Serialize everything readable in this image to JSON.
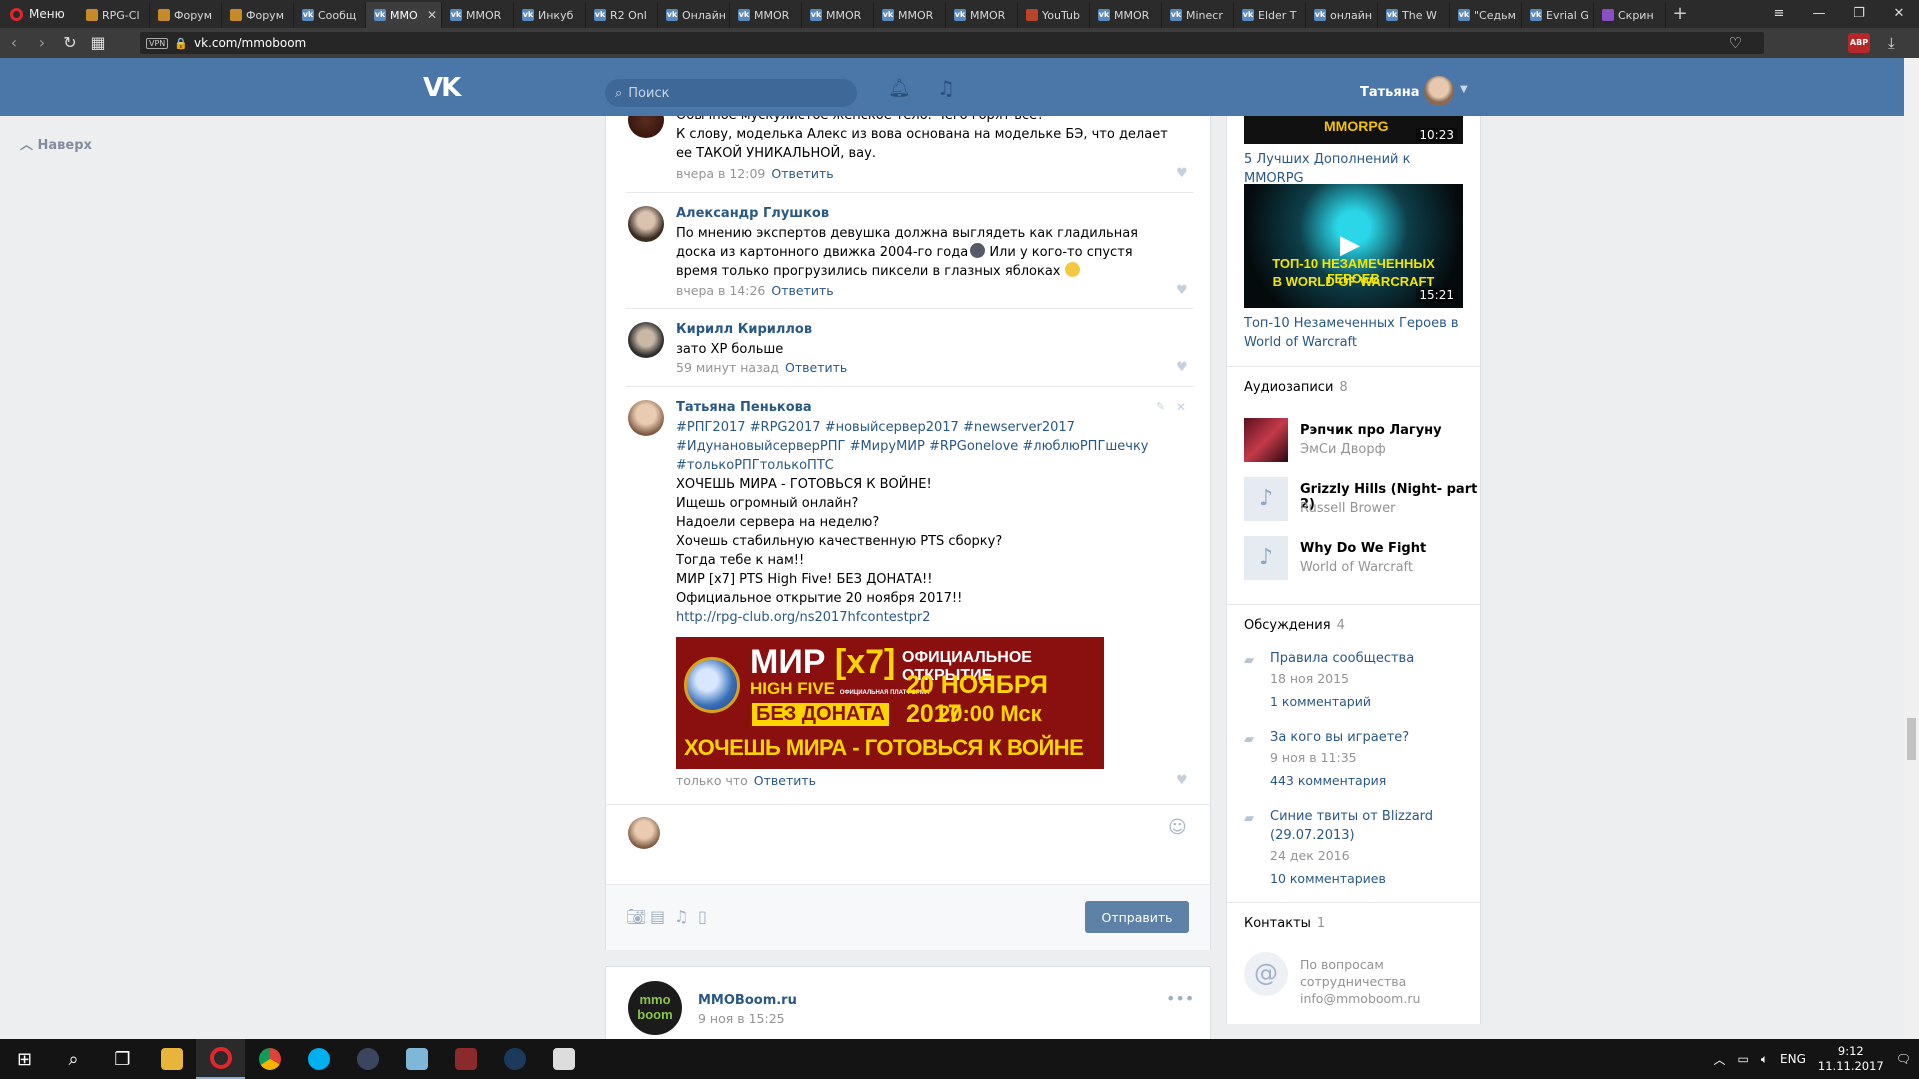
{
  "browser": {
    "menu_label": "Меню",
    "tabs": [
      {
        "label": "RPG-Cl",
        "icon": "f-orange"
      },
      {
        "label": "Форум",
        "icon": "f-orange"
      },
      {
        "label": "Форум",
        "icon": "f-orange"
      },
      {
        "label": "Сообщ",
        "icon": "vk"
      },
      {
        "label": "MMO",
        "icon": "vk",
        "active": true
      },
      {
        "label": "MMOR",
        "icon": "vk"
      },
      {
        "label": "Инкуб",
        "icon": "vk"
      },
      {
        "label": "R2 Onl",
        "icon": "vk"
      },
      {
        "label": "Онлайн",
        "icon": "vk"
      },
      {
        "label": "MMOR",
        "icon": "vk"
      },
      {
        "label": "MMOR",
        "icon": "vk"
      },
      {
        "label": "MMOR",
        "icon": "vk"
      },
      {
        "label": "MMOR",
        "icon": "vk"
      },
      {
        "label": "YouTub",
        "icon": "f-red"
      },
      {
        "label": "MMOR",
        "icon": "vk"
      },
      {
        "label": "Minecr",
        "icon": "vk"
      },
      {
        "label": "Elder T",
        "icon": "vk"
      },
      {
        "label": "онлайн",
        "icon": "vk"
      },
      {
        "label": "The W",
        "icon": "vk"
      },
      {
        "label": "\"Седьм",
        "icon": "vk"
      },
      {
        "label": "Evrial G",
        "icon": "vk"
      },
      {
        "label": "Скрин",
        "icon": "f-purple"
      }
    ],
    "url": "vk.com/mmoboom",
    "vpn_label": "VPN",
    "adblock_label": "ABP"
  },
  "header": {
    "search_placeholder": "Поиск",
    "username": "Татьяна"
  },
  "left": {
    "back_to_top": "Наверх"
  },
  "comments": [
    {
      "author": "",
      "text": "Обычное мускулистое женское тело. Чего горят все?\nК слову, моделька Алекс из вова основана на модельке БЭ, что делает ее ТАКОЙ УНИКАЛЬНОЙ, вау.",
      "time": "вчера в 12:09",
      "reply": "Ответить"
    },
    {
      "author": "Александр Глушков",
      "text": "По мнению экспертов девушка должна выглядеть как гладильная доска из картонного движка 2004-го года",
      "text2": " Или у кого-то спустя время только прогрузились пиксели в глазных яблоках ",
      "time": "вчера в 14:26",
      "reply": "Ответить"
    },
    {
      "author": "Кирилл Кириллов",
      "text": "зато XP больше",
      "time": "59 минут назад",
      "reply": "Ответить"
    },
    {
      "author": "Татьяна Пенькова",
      "tags": "#РПГ2017 #RPG2017 #новыйсервер2017 #newserver2017 #ИдунановыйсерверРПГ #МируМИР #RPGonelove #люблюРПГшечку #толькоРПГтолькоПТС",
      "lines": [
        "ХОЧЕШЬ МИРА - ГОТОВЬСЯ К ВОЙНЕ!",
        "Ищешь огромный онлайн?",
        "Надоели сервера на неделю?",
        "Хочешь стабильную качественную PTS сборку?",
        "Тогда тебе к нам!!",
        "МИР [x7] PTS High Five! БЕЗ ДОНАТА!!",
        "Официальное открытие 20 ноября 2017!!"
      ],
      "link": "http://rpg-club.org/ns2017hfcontestpr2",
      "time": "только что",
      "reply": "Ответить"
    }
  ],
  "banner": {
    "title_a": "МИР",
    "title_b": "[x7]",
    "sub_small": "ОФИЦИАЛЬНАЯ ПЛАТФОРМА",
    "high_five": "HIGH FIVE",
    "no_donate": "БЕЗ ДОНАТА",
    "opening": "ОФИЦИАЛЬНОЕ ОТКРЫТИЕ",
    "date": "20 НОЯБРЯ 2017",
    "time": "20:00 Мск",
    "slogan": "ХОЧЕШЬ МИРА - ГОТОВЬСЯ К ВОЙНЕ"
  },
  "reply_box": {
    "send": "Отправить"
  },
  "next_post": {
    "avatar_text_1": "mmo",
    "avatar_text_2": "boom",
    "name": "MMOBoom.ru",
    "date": "9 ноя в 15:25"
  },
  "right": {
    "videos": [
      {
        "thumb_text": "MMORPG",
        "duration": "10:23",
        "title": "5 Лучших Дополнений к MMORPG"
      },
      {
        "thumb_text_1": "ТОП-10 НЕЗАМЕЧЕННЫХ ГЕРОЕВ",
        "thumb_text_2": "В WORLD OF WARCRAFT",
        "duration": "15:21",
        "title": "Топ-10 Незамеченных Героев в World of Warcraft"
      }
    ],
    "audio_header": "Аудиозаписи",
    "audio_count": "8",
    "audio": [
      {
        "title": "Рэпчик про Лагуну",
        "artist": "ЭмСи Дворф"
      },
      {
        "title": "Grizzly Hills (Night- part 2)",
        "artist": "Russell Brower"
      },
      {
        "title": "Why Do We Fight",
        "artist": "World of Warcraft"
      }
    ],
    "discussions_header": "Обсуждения",
    "discussions_count": "4",
    "discussions": [
      {
        "title": "Правила сообщества",
        "date": "18 ноя 2015",
        "count": "1 комментарий"
      },
      {
        "title": "За кого вы играете?",
        "date": "9 ноя в 11:35",
        "count": "443 комментария"
      },
      {
        "title": "Синие твиты от Blizzard (29.07.2013)",
        "date": "24 дек 2016",
        "count": "10 комментариев"
      }
    ],
    "contacts_header": "Контакты",
    "contacts_count": "1",
    "contact_line1": "По вопросам",
    "contact_line2": "сотрудничества",
    "contact_email": "info@mmoboom.ru"
  },
  "taskbar": {
    "lang": "ENG",
    "time": "9:12",
    "date": "11.11.2017"
  }
}
